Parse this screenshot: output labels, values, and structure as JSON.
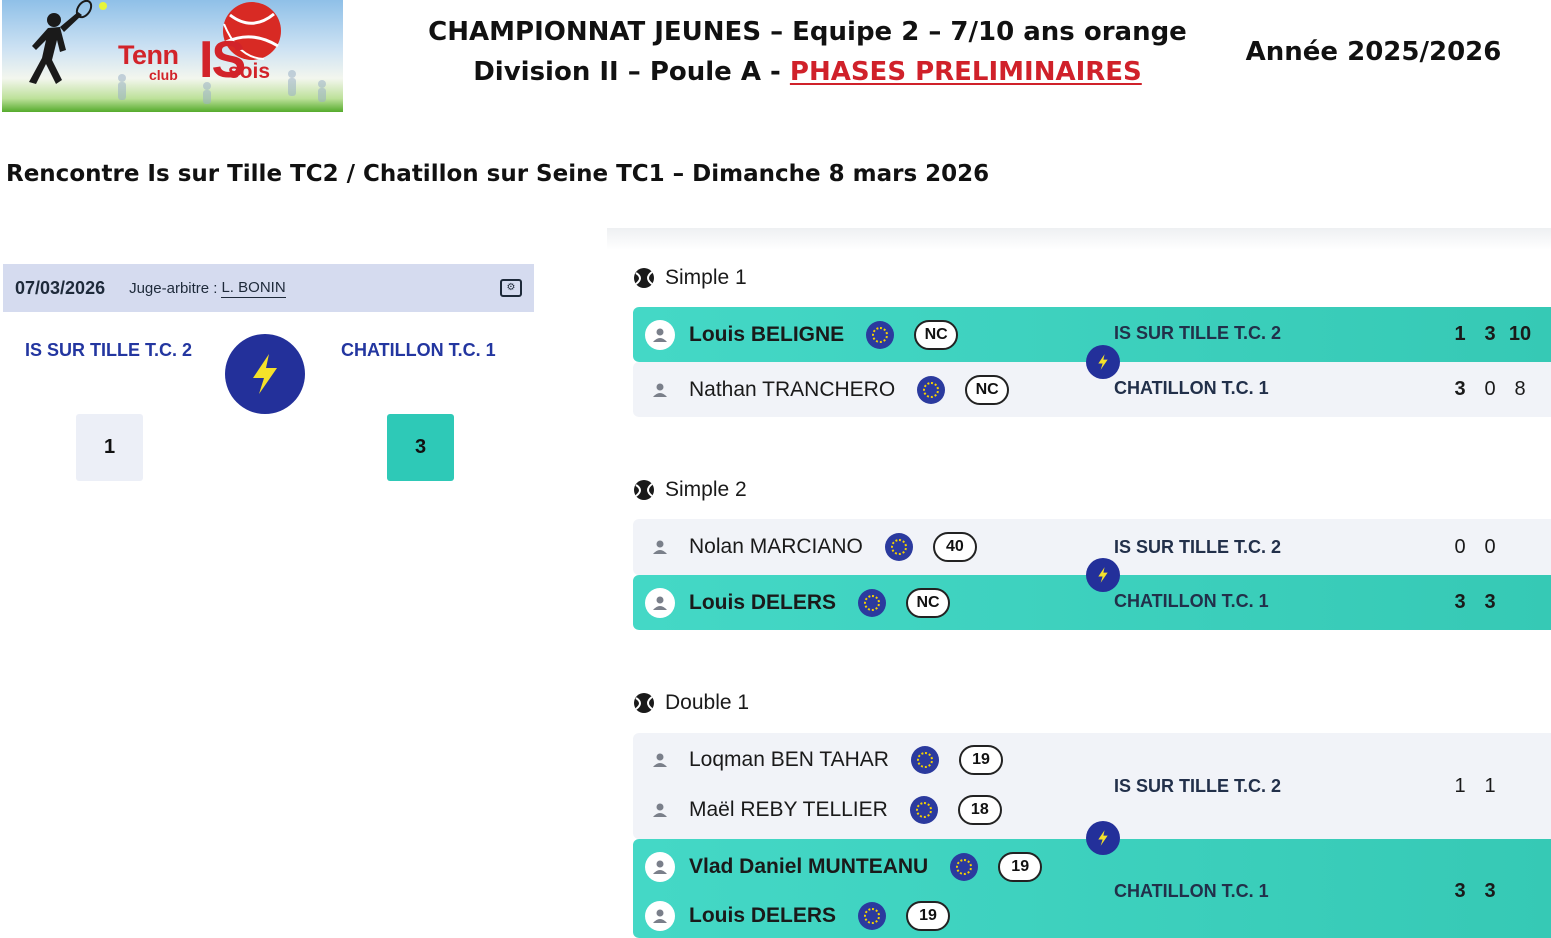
{
  "logo": {
    "tenn": "Tenn",
    "club": "club",
    "is": "IS",
    "sois": "sois"
  },
  "header": {
    "title_line1": "CHAMPIONNAT JEUNES – Equipe 2 – 7/10 ans orange",
    "title_line2_prefix": "Division II – Poule A - ",
    "title_line2_phase": "PHASES PRELIMINAIRES",
    "season": "Année 2025/2026",
    "encounter": "Rencontre Is sur Tille TC2 / Chatillon sur Seine TC1 – Dimanche 8 mars 2026"
  },
  "result_card": {
    "date": "07/03/2026",
    "judge_label": "Juge-arbitre :",
    "judge_name": "L. BONIN",
    "home_team": "IS SUR TILLE T.C. 2",
    "away_team": "CHATILLON T.C. 1",
    "home_score": "1",
    "away_score": "3"
  },
  "matches": {
    "simple1": {
      "label": "Simple 1",
      "home_player": "Louis BELIGNE",
      "home_rank": "NC",
      "home_club": "IS SUR TILLE T.C. 2",
      "home_s1": "1",
      "home_s2": "3",
      "home_s3": "10",
      "away_player": "Nathan TRANCHERO",
      "away_rank": "NC",
      "away_club": "CHATILLON T.C. 1",
      "away_s1": "3",
      "away_s2": "0",
      "away_s3": "8",
      "winner": "home"
    },
    "simple2": {
      "label": "Simple 2",
      "home_player": "Nolan MARCIANO",
      "home_rank": "40",
      "home_club": "IS SUR TILLE T.C. 2",
      "home_s1": "0",
      "home_s2": "0",
      "away_player": "Louis DELERS",
      "away_rank": "NC",
      "away_club": "CHATILLON T.C. 1",
      "away_s1": "3",
      "away_s2": "3",
      "winner": "away"
    },
    "double1": {
      "label": "Double 1",
      "home_player1": "Loqman BEN TAHAR",
      "home_rank1": "19",
      "home_player2": "Maël REBY TELLIER",
      "home_rank2": "18",
      "home_club": "IS SUR TILLE T.C. 2",
      "home_s1": "1",
      "home_s2": "1",
      "away_player1": "Vlad Daniel MUNTEANU",
      "away_rank1": "19",
      "away_player2": "Louis DELERS",
      "away_rank2": "19",
      "away_club": "CHATILLON T.C. 1",
      "away_s1": "3",
      "away_s2": "3",
      "winner": "away"
    }
  },
  "colors": {
    "winner_row": "#3dcfbd",
    "loser_row": "#f1f3f8",
    "navy": "#23309a",
    "team_text": "#2336a0",
    "phase_red": "#d0212a",
    "bolt_yellow": "#f5e12a",
    "card_header": "#d5dbef"
  },
  "icons": {
    "vs": "lightning-icon",
    "match": "tennis-ball-icon",
    "player": "user-icon",
    "nationality": "eu-flag-icon",
    "settings": "settings-icon"
  }
}
